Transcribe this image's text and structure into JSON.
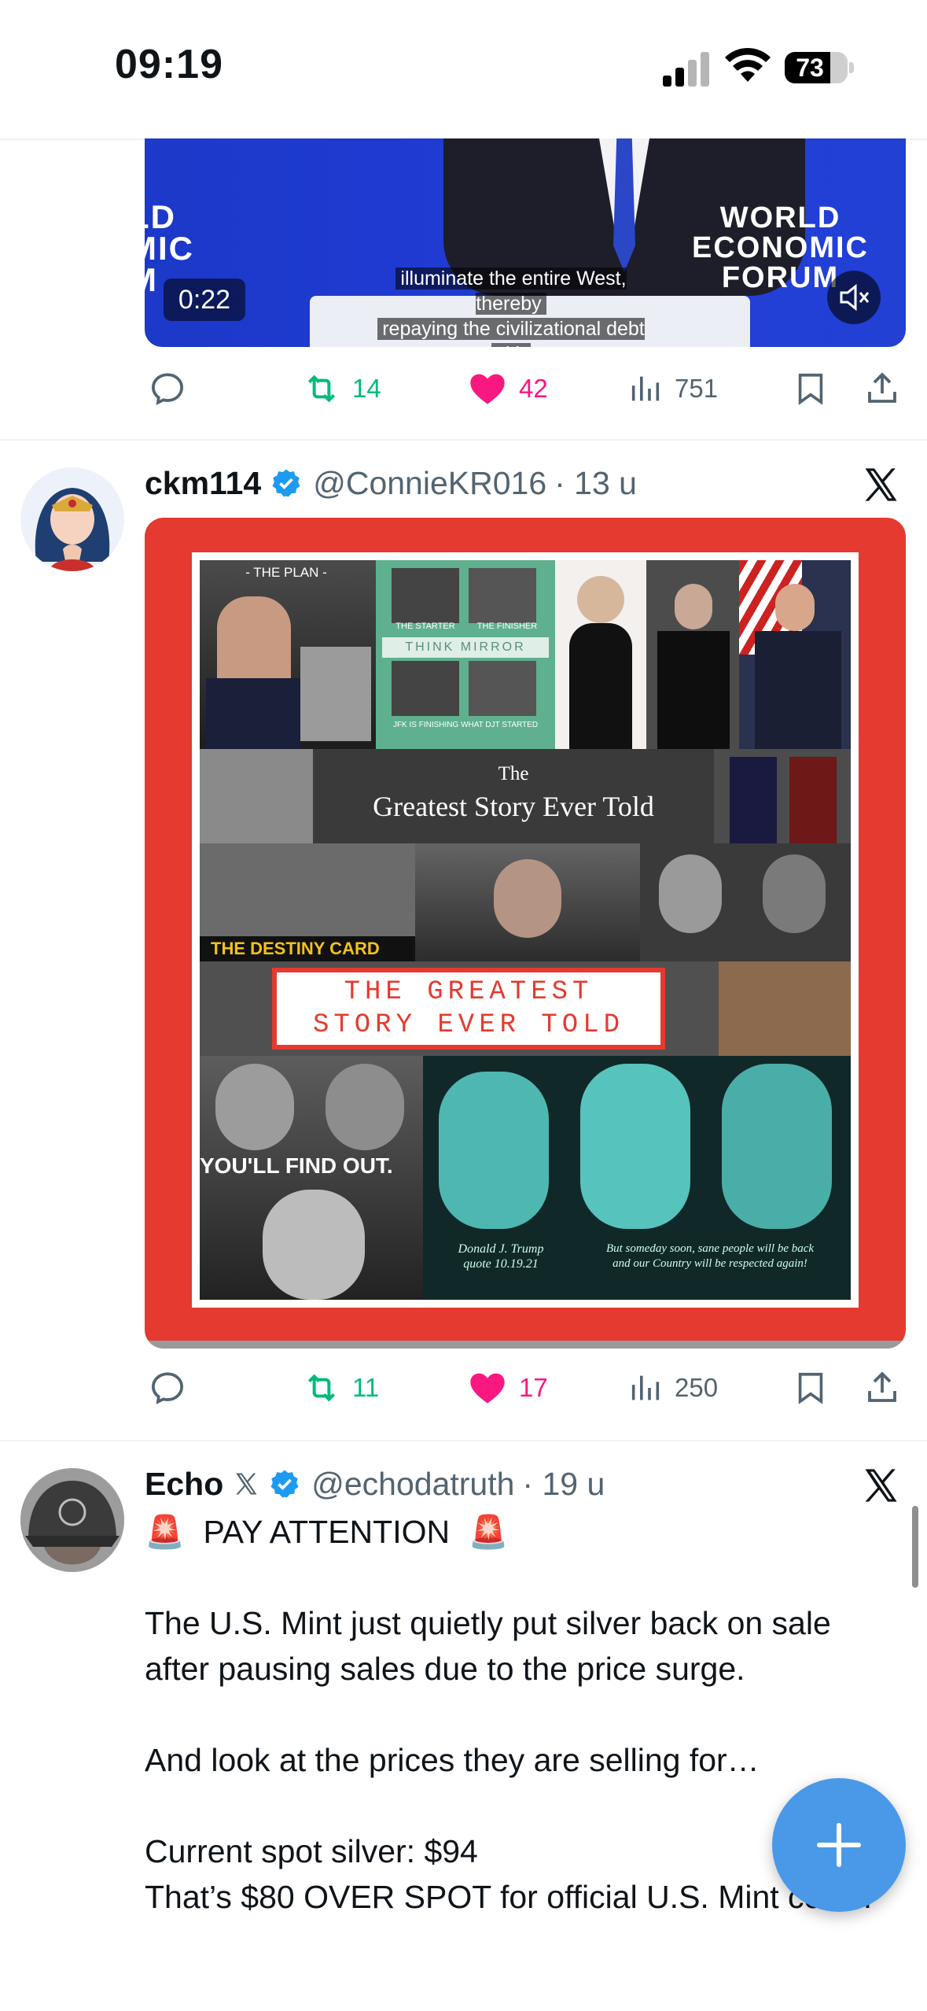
{
  "status_bar": {
    "time": "09:19",
    "battery": "73",
    "battery_level": 0.73
  },
  "tweet1": {
    "video": {
      "duration": "0:22",
      "caption_line1": "illuminate the entire West, thereby",
      "caption_line2": "repaying the civilizational debt with",
      "logo_left": "LD\nMIC\nM",
      "logo_right": "WORLD\nECONOMIC\nFORUM"
    },
    "actions": {
      "reposts": "14",
      "likes": "42",
      "views": "751"
    }
  },
  "tweet2": {
    "name": "ckm114",
    "handle": "@ConnieKR016",
    "time": "· 13 u",
    "image": {
      "the_plan": "- THE PLAN -",
      "the_starter": "THE STARTER",
      "the_finisher": "THE FINISHER",
      "think_mirror": "THINK MIRROR",
      "jfk_caption": "JFK IS FINISHING WHAT DJT STARTED",
      "the": "The",
      "greatest_story": "Greatest Story Ever Told",
      "destiny_card": "THE DESTINY CARD",
      "banner_line1": "THE GREATEST",
      "banner_line2": "STORY EVER TOLD",
      "find_out": "YOU'LL FIND OUT.",
      "quote_trump": "Donald J. Trump\nquote 10.19.21",
      "quote_back": "But someday soon, sane people will be back\nand our Country will be respected again!"
    },
    "actions": {
      "reposts": "11",
      "likes": "17",
      "views": "250"
    }
  },
  "tweet3": {
    "name": "Echo",
    "handle": "@echodatruth",
    "time": "· 19 u",
    "alert_emoji": "🚨",
    "headline": "PAY ATTENTION",
    "para1": "The U.S. Mint just quietly put silver back on sale after pausing sales due to the price surge.",
    "para2": "And look at the prices they are selling for…",
    "para3_line1": "Current spot silver: $94",
    "para3_line2": "That’s $80 OVER SPOT for official U.S. Mint coins."
  },
  "icons": {
    "reply": "reply-icon",
    "repost": "repost-icon",
    "like": "heart-icon",
    "views": "views-icon",
    "bookmark": "bookmark-icon",
    "share": "share-icon",
    "compose": "plus-icon",
    "grok": "x-logo-icon",
    "verified": "verified-badge-icon"
  },
  "colors": {
    "accent": "#1d9bf0",
    "like": "#f91880",
    "repost": "#00ba7c",
    "fab": "#4a99e9"
  }
}
